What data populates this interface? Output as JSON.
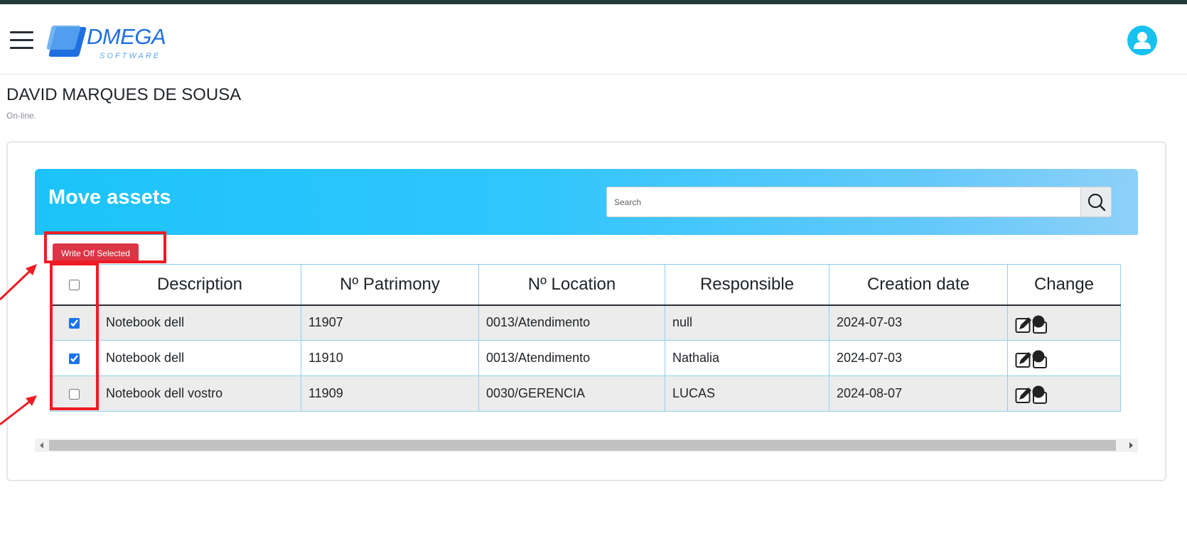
{
  "brand": {
    "name": "DMEGA",
    "subtitle": "SOFTWARE",
    "accent": "#1f6fe0"
  },
  "user": {
    "name": "DAVID MARQUES DE SOUSA",
    "status": "On-line."
  },
  "panel": {
    "title": "Move assets",
    "search_placeholder": "Search",
    "write_off_label": "Write Off Selected",
    "write_off_color": "#dc3545"
  },
  "table": {
    "headers": {
      "description": "Description",
      "patrimony": "Nº Patrimony",
      "location": "Nº Location",
      "responsible": "Responsible",
      "creation_date": "Creation date",
      "change": "Change"
    },
    "select_all_checked": false,
    "rows": [
      {
        "checked": true,
        "description": "Notebook dell",
        "patrimony": "11907",
        "location": "0013/Atendimento",
        "responsible": "null",
        "creation_date": "2024-07-03",
        "action_icon": "edit-icon"
      },
      {
        "checked": true,
        "description": "Notebook dell",
        "patrimony": "11910",
        "location": "0013/Atendimento",
        "responsible": "Nathalia",
        "creation_date": "2024-07-03",
        "action_icon": "edit-icon"
      },
      {
        "checked": false,
        "description": "Notebook dell vostro",
        "patrimony": "11909",
        "location": "0030/GERENCIA",
        "responsible": "LUCAS",
        "creation_date": "2024-08-07",
        "action_icon": "edit-icon"
      }
    ]
  },
  "icons": {
    "menu": "hamburger-icon",
    "profile": "user-icon",
    "search": "search-icon",
    "edit": "edit-icon"
  },
  "colors": {
    "header_gradient_start": "#1cc3fb",
    "header_gradient_end": "#8dd0f7",
    "annotation": "#ed1c24",
    "avatar": "#17c1f0"
  }
}
